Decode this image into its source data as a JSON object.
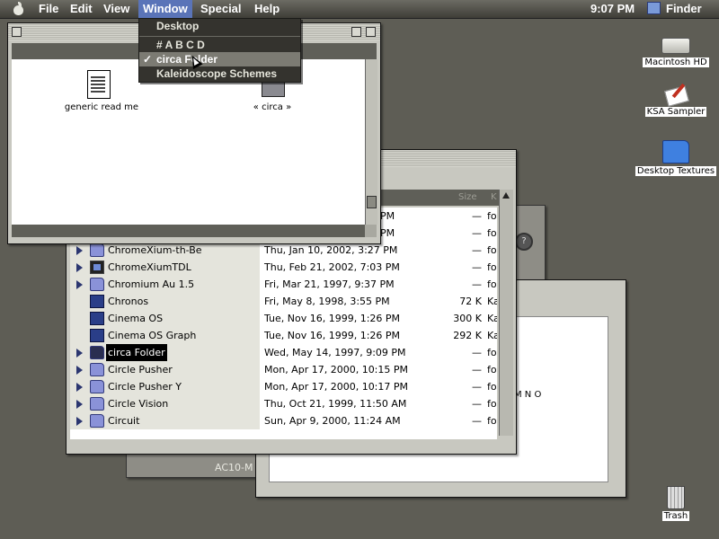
{
  "menubar": {
    "items": [
      "File",
      "Edit",
      "View",
      "Window",
      "Special",
      "Help"
    ],
    "active": "Window",
    "clock": "9:07 PM",
    "app_name": "Finder"
  },
  "window_menu": {
    "items": [
      {
        "label": "Desktop",
        "checked": false
      },
      {
        "label": "# A B C D",
        "checked": false
      },
      {
        "label": "circa Folder",
        "checked": true
      },
      {
        "label": "Kaleidoscope Schemes",
        "checked": false
      }
    ],
    "check_glyph": "✓"
  },
  "top_window": {
    "icons": [
      "generic read me",
      "« circa »"
    ]
  },
  "list_window": {
    "headers": {
      "size": "Size",
      "kind": "K"
    },
    "rows": [
      {
        "name": "",
        "date": "PM",
        "size": "—",
        "kind": "fol"
      },
      {
        "name": "",
        "date": "PM",
        "size": "—",
        "kind": "fol"
      },
      {
        "name": "ChromeXium-th-Be",
        "date": "Thu, Jan 10, 2002, 3:27 PM",
        "size": "—",
        "kind": "fol"
      },
      {
        "name": "ChromeXiumTDL",
        "date": "Thu, Feb 21, 2002, 7:03 PM",
        "size": "—",
        "kind": "fol"
      },
      {
        "name": "Chromium Au 1.5",
        "date": "Fri, Mar 21, 1997, 9:37 PM",
        "size": "—",
        "kind": "fol"
      },
      {
        "name": "Chronos",
        "date": "Fri, May 8, 1998, 3:55 PM",
        "size": "72 K",
        "kind": "Ka"
      },
      {
        "name": "Cinema OS",
        "date": "Tue, Nov 16, 1999, 1:26 PM",
        "size": "300 K",
        "kind": "Ka"
      },
      {
        "name": "Cinema OS Graph",
        "date": "Tue, Nov 16, 1999, 1:26 PM",
        "size": "292 K",
        "kind": "Ka"
      },
      {
        "name": "circa Folder",
        "date": "Wed, May 14, 1997, 9:09 PM",
        "size": "—",
        "kind": "fol"
      },
      {
        "name": "Circle Pusher",
        "date": "Mon, Apr 17, 2000, 10:15 PM",
        "size": "—",
        "kind": "fol"
      },
      {
        "name": "Circle Pusher Y",
        "date": "Mon, Apr 17, 2000, 10:17 PM",
        "size": "—",
        "kind": "fol"
      },
      {
        "name": "Circle Vision",
        "date": "Thu, Oct 21, 1999, 11:50 AM",
        "size": "—",
        "kind": "fol"
      },
      {
        "name": "Circuit",
        "date": "Sun, Apr 9, 2000, 11:24 AM",
        "size": "—",
        "kind": "fol"
      }
    ]
  },
  "back_window": {
    "label": "AC10-M"
  },
  "right_window": {
    "label": "M N O"
  },
  "desktop": {
    "icons": [
      "Macintosh HD",
      "KSA Sampler",
      "Desktop Textures",
      "Trash"
    ]
  }
}
